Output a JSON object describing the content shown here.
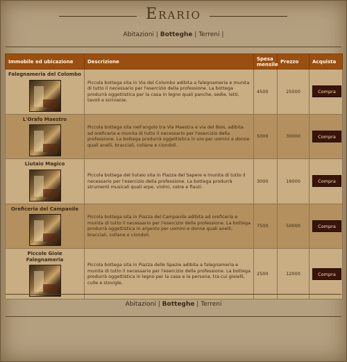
{
  "site": {
    "title": "Erario"
  },
  "nav": {
    "items": [
      {
        "label": "Abitazioni"
      },
      {
        "label": "Botteghe"
      },
      {
        "label": "Terreni"
      }
    ],
    "separator": "|"
  },
  "table": {
    "headers": {
      "name": "Immobile ed ubicazione",
      "description": "Descrizione",
      "cost": "Spesa mensile",
      "price": "Prezzo",
      "buy": "Acquista"
    },
    "rows": [
      {
        "name": "Falegnameria del Colombo",
        "description": "Piccola bottega sita in Via del Colombo adibita a falegnameria e munita di tutto il necessario per l'esercizio della professione. La bottega produrrà oggettistica per la casa in legno quali panche, sedie, letti, tavoli e scrivanie.",
        "cost": "4500",
        "price": "25000",
        "button": "Compra"
      },
      {
        "name": "L'Orafo Maestro",
        "description": "Piccola bottega sita nell'angolo tra Via Maestra e via del Bois, adibita ad oreficeria e munita di tutto il necessario per l'esercizio della professione. La bottega produrrà oggettistica in oro per uomini e donne quali anelli, bracciali, collane e ciondoli.",
        "cost": "5000",
        "price": "30000",
        "button": "Compra"
      },
      {
        "name": "Liutaio Magico",
        "description": "Piccola bottega del liutaio sita in Piazza del Sapere e munita di tutto il necessario per l'esercizio della professione. La bottega produrrà strumenti musicali quali arpe, violini, cetre e flauti.",
        "cost": "3000",
        "price": "19000",
        "button": "Compra"
      },
      {
        "name": "Oreficeria del Campanile",
        "description": "Piccola bottega sita in Piazza del Campanile adibita ad oreficeria e munita di tutto il necessario per l'esercizio della professione. La bottega produrrà oggettistica in argento per uomini e donne quali anelli, bracciali, collane e ciondoli.",
        "cost": "7500",
        "price": "50000",
        "button": "Compra"
      },
      {
        "name": "Piccole Gioie Falegnameria",
        "description": "Piccola bottega sita in Piazza delle Spezie adibita a falegnameria e munita di tutto il necessario per l'esercizio della professione. La bottega produrrà oggettistica in legno per la casa e la persona, tra cui gioielli, culle e stovigle.",
        "cost": "2500",
        "price": "12000",
        "button": "Compra"
      }
    ]
  }
}
